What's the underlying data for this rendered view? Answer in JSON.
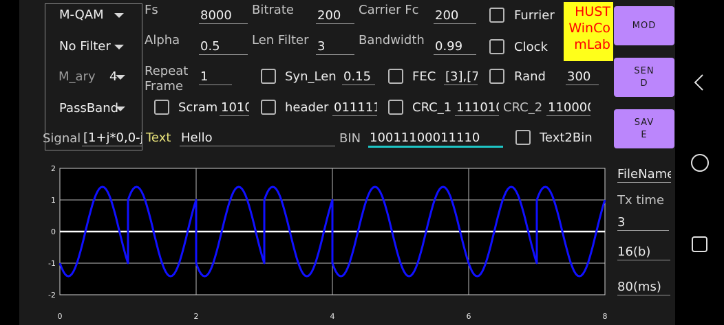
{
  "spinners": {
    "modulation": "M-QAM",
    "filter": "No Filter",
    "mary_label": "M_ary",
    "mary_value": "4",
    "band": "PassBand"
  },
  "params": {
    "fs_label": "Fs",
    "fs_value": "8000",
    "bitrate_label": "Bitrate",
    "bitrate_value": "200",
    "carrier_label": "Carrier Fc",
    "carrier_value": "200",
    "alpha_label": "Alpha",
    "alpha_value": "0.5",
    "lenfilter_label": "Len Filter",
    "lenfilter_value": "3",
    "bandwidth_label": "Bandwidth",
    "bandwidth_value": "0.99",
    "repeat_label_1": "Repeat",
    "repeat_label_2": "Frame",
    "repeat_value": "1",
    "synlen_label": "Syn_Len",
    "synlen_value": "0.15",
    "fec_label": "FEC",
    "fec_value": "[3],[7,",
    "rand_label": "Rand",
    "rand_value": "300",
    "scram_label": "Scram",
    "scram_value": "1010",
    "header_label": "header",
    "header_value": "011111",
    "crc1_label": "CRC_1",
    "crc1_value": "111010",
    "crc2_label": "CRC_2",
    "crc2_value": "110000",
    "signal_label": "Signal",
    "signal_value": "[1+j*0,0-j*",
    "text_label": "Text",
    "text_value": "Hello",
    "bin_label": "BIN",
    "bin_value": "10011100011110",
    "text2bin_label": "Text2Bin",
    "furrier_label": "Furrier",
    "clock_label": "Clock"
  },
  "logo": {
    "text": "HUSTWinComLab"
  },
  "buttons": {
    "mod": "MOD",
    "send": "SEN\nD",
    "save": "SAV\nE"
  },
  "side_panel": {
    "filename": "FileName",
    "tx_time_label": "Tx time",
    "tx_time_value": "3",
    "bits_value": "16(b)",
    "ms_value": "80(ms)"
  },
  "colors": {
    "accent": "#bb86fc",
    "focus_underline": "#1ec5c5",
    "signal_line": "#1010ff",
    "logo_bg": "#ffff1a",
    "logo_text": "#ff0000",
    "text_label": "#e8e27a"
  },
  "chart_data": {
    "type": "line",
    "title": "",
    "xlabel": "",
    "ylabel": "",
    "xlim": [
      0,
      8
    ],
    "ylim": [
      -2,
      2
    ],
    "x_ticks": [
      "0",
      "2",
      "4",
      "6",
      "8"
    ],
    "y_ticks": [
      "2",
      "1",
      "0",
      "-1",
      "-2"
    ],
    "grid": true,
    "series": [
      {
        "symbols": [
          [
            -1,
            1
          ],
          [
            1,
            -1
          ],
          [
            -1,
            1
          ],
          [
            1,
            -1
          ],
          [
            -1,
            1
          ],
          [
            -1,
            1
          ],
          [
            -1,
            1
          ],
          [
            1,
            -1
          ]
        ],
        "samples_per_symbol": 40,
        "carrier_cycles_per_symbol": 1,
        "color": "#1010ff"
      }
    ]
  }
}
